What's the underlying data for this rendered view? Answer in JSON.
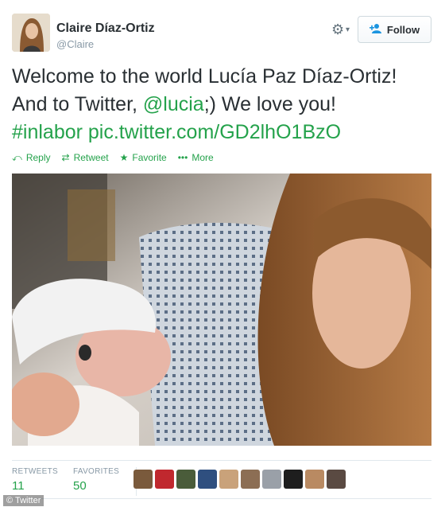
{
  "user": {
    "name": "Claire Díaz-Ortiz",
    "handle": "@Claire",
    "avatar_icon": "user-avatar"
  },
  "follow_button": {
    "label": "Follow",
    "icon": "add-user-icon"
  },
  "settings_icon": "gear-icon",
  "tweet": {
    "line1": "Welcome to the world Lucía Paz Díaz-Ortiz!",
    "line2_prefix": "And to Twitter, ",
    "mention": "@lucia",
    "line2_suffix": ";) We love you!",
    "hashtag": "#inlabor",
    "pic_link": "pic.twitter.com/GD2lhO1BzO"
  },
  "actions": [
    {
      "label": "Reply",
      "icon": "reply-icon"
    },
    {
      "label": "Retweet",
      "icon": "retweet-icon"
    },
    {
      "label": "Favorite",
      "icon": "star-icon"
    },
    {
      "label": "More",
      "icon": "more-dots-icon"
    }
  ],
  "stats": {
    "retweets_label": "RETWEETS",
    "retweets_value": "11",
    "favorites_label": "FAVORITES",
    "favorites_value": "50"
  },
  "favoriter_count_shown": 10,
  "watermark": "© Twitter",
  "colors": {
    "link": "#24a24b",
    "text": "#292f33",
    "muted": "#8899a6",
    "follow_icon": "#1b95e0"
  }
}
